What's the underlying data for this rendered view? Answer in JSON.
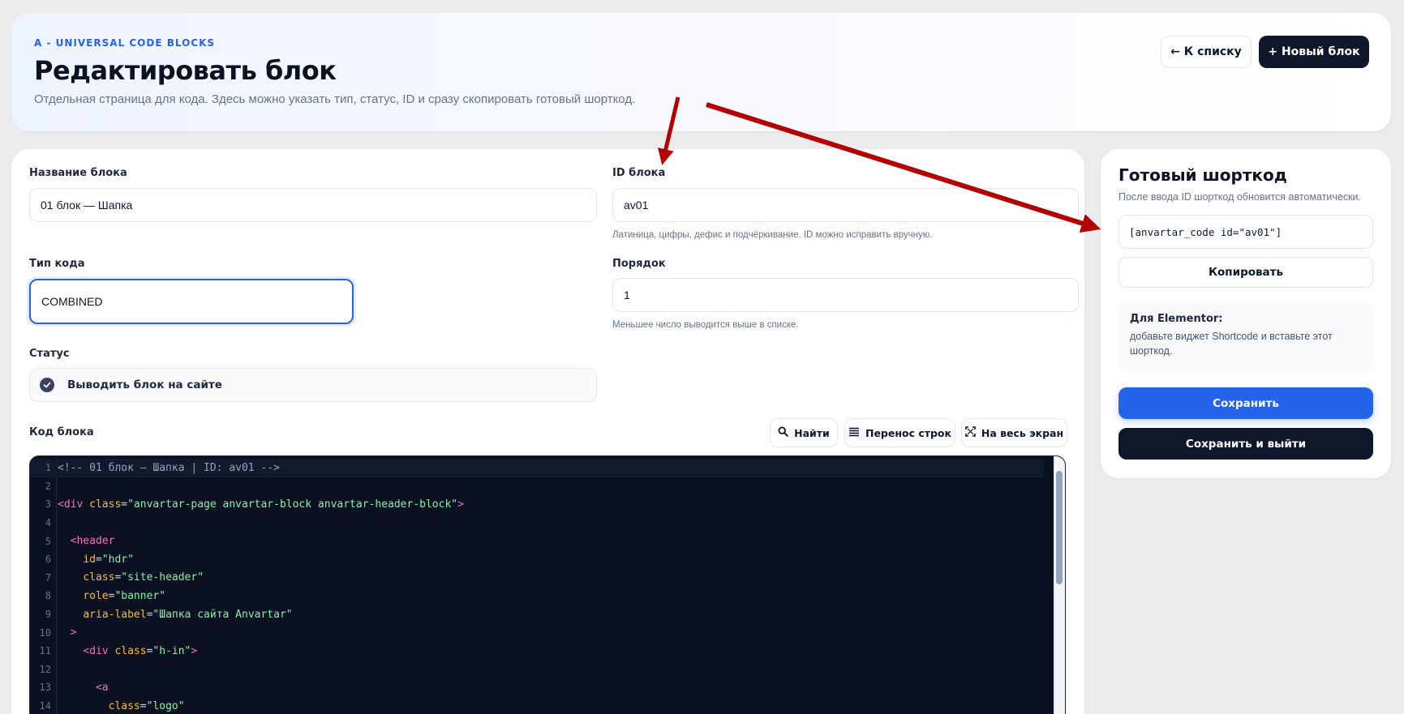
{
  "header": {
    "eyebrow": "A - UNIVERSAL CODE BLOCKS",
    "title": "Редактировать блок",
    "description": "Отдельная страница для кода. Здесь можно указать тип, статус, ID и сразу скопировать готовый шорткод.",
    "back_label": "← К списку",
    "new_label": "+ Новый блок"
  },
  "form": {
    "name_label": "Название блока",
    "name_value": "01 блок — Шапка",
    "id_label": "ID блока",
    "id_value": "av01",
    "id_hint": "Латиница, цифры, дефис и подчёркивание. ID можно исправить вручную.",
    "type_label": "Тип кода",
    "type_value": "COMBINED",
    "order_label": "Порядок",
    "order_value": "1",
    "order_hint": "Меньшее число выводится выше в списке.",
    "status_label": "Статус",
    "status_text": "Выводить блок на сайте",
    "code_label": "Код блока",
    "find_label": "Найти",
    "wrap_label": "Перенос строк",
    "fullscreen_label": "На весь экран"
  },
  "code_lines": [
    {
      "n": "1",
      "tokens": [
        [
          "c-comment",
          "<!-- 01 блок — Шапка | ID: av01 -->"
        ]
      ]
    },
    {
      "n": "2",
      "tokens": []
    },
    {
      "n": "3",
      "tokens": [
        [
          "c-tag",
          "<div"
        ],
        [
          "c-pun",
          " "
        ],
        [
          "c-attr",
          "class"
        ],
        [
          "c-pun",
          "="
        ],
        [
          "c-str",
          "\"anvartar-page anvartar-block anvartar-header-block\""
        ],
        [
          "c-tag",
          ">"
        ]
      ]
    },
    {
      "n": "4",
      "tokens": []
    },
    {
      "n": "5",
      "tokens": [
        [
          "c-pun",
          "  "
        ],
        [
          "c-tag",
          "<header"
        ]
      ]
    },
    {
      "n": "6",
      "tokens": [
        [
          "c-pun",
          "    "
        ],
        [
          "c-attr",
          "id"
        ],
        [
          "c-pun",
          "="
        ],
        [
          "c-str",
          "\"hdr\""
        ]
      ]
    },
    {
      "n": "7",
      "tokens": [
        [
          "c-pun",
          "    "
        ],
        [
          "c-attr",
          "class"
        ],
        [
          "c-pun",
          "="
        ],
        [
          "c-str",
          "\"site-header\""
        ]
      ]
    },
    {
      "n": "8",
      "tokens": [
        [
          "c-pun",
          "    "
        ],
        [
          "c-attr",
          "role"
        ],
        [
          "c-pun",
          "="
        ],
        [
          "c-str",
          "\"banner\""
        ]
      ]
    },
    {
      "n": "9",
      "tokens": [
        [
          "c-pun",
          "    "
        ],
        [
          "c-attr",
          "aria-label"
        ],
        [
          "c-pun",
          "="
        ],
        [
          "c-str",
          "\"Шапка сайта Anvartar\""
        ]
      ]
    },
    {
      "n": "10",
      "tokens": [
        [
          "c-pun",
          "  "
        ],
        [
          "c-tag",
          ">"
        ]
      ]
    },
    {
      "n": "11",
      "tokens": [
        [
          "c-pun",
          "    "
        ],
        [
          "c-tag",
          "<div"
        ],
        [
          "c-pun",
          " "
        ],
        [
          "c-attr",
          "class"
        ],
        [
          "c-pun",
          "="
        ],
        [
          "c-str",
          "\"h-in\""
        ],
        [
          "c-tag",
          ">"
        ]
      ]
    },
    {
      "n": "12",
      "tokens": []
    },
    {
      "n": "13",
      "tokens": [
        [
          "c-pun",
          "      "
        ],
        [
          "c-tag",
          "<a"
        ]
      ]
    },
    {
      "n": "14",
      "tokens": [
        [
          "c-pun",
          "        "
        ],
        [
          "c-attr",
          "class"
        ],
        [
          "c-pun",
          "="
        ],
        [
          "c-str",
          "\"logo\""
        ]
      ]
    }
  ],
  "sidebar": {
    "title": "Готовый шорткод",
    "subtitle": "После ввода ID шорткод обновится автоматически.",
    "shortcode": "[anvartar_code id=\"av01\"]",
    "copy_label": "Копировать",
    "elementor_title": "Для Elementor:",
    "elementor_text": "добавьте виджет Shortcode и вставьте этот шорткод.",
    "save_label": "Сохранить",
    "save_exit_label": "Сохранить и выйти"
  },
  "colors": {
    "accent": "#2563eb",
    "dark": "#0f172a",
    "annotation_arrow": "#b30000"
  }
}
